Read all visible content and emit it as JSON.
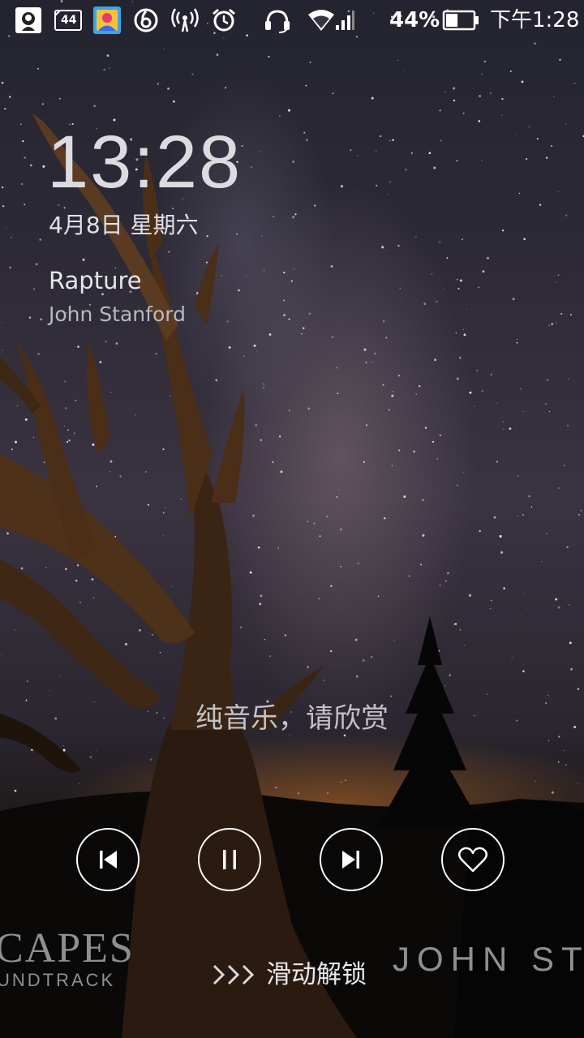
{
  "status_bar": {
    "icons": [
      "app-notification-icon",
      "sim-4g-icon",
      "photo-app-icon",
      "music-app-icon",
      "hotspot-icon",
      "alarm-icon",
      "headset-icon",
      "wifi-icon",
      "cellular-signal-icon",
      "battery-icon"
    ],
    "sim_label": "44",
    "battery_percent": "44%",
    "battery_level": 0.44,
    "time": "下午1:28"
  },
  "lock": {
    "clock": "13:28",
    "date": "4月8日 星期六"
  },
  "now_playing": {
    "title": "Rapture",
    "artist": "John Stanford",
    "lyric": "纯音乐，请欣赏"
  },
  "controls": {
    "icons": [
      "previous-icon",
      "pause-icon",
      "next-icon",
      "heart-icon"
    ]
  },
  "album_art": {
    "left_big": "CAPES",
    "left_small": "UNDTRACK",
    "right": "JOHN STA"
  },
  "unlock": {
    "label": "滑动解锁",
    "icon": "triple-chevron-right-icon"
  },
  "colors": {
    "text_primary": "#e6e6ea",
    "text_secondary": "#b9b9be",
    "accent_white": "#ffffff"
  }
}
